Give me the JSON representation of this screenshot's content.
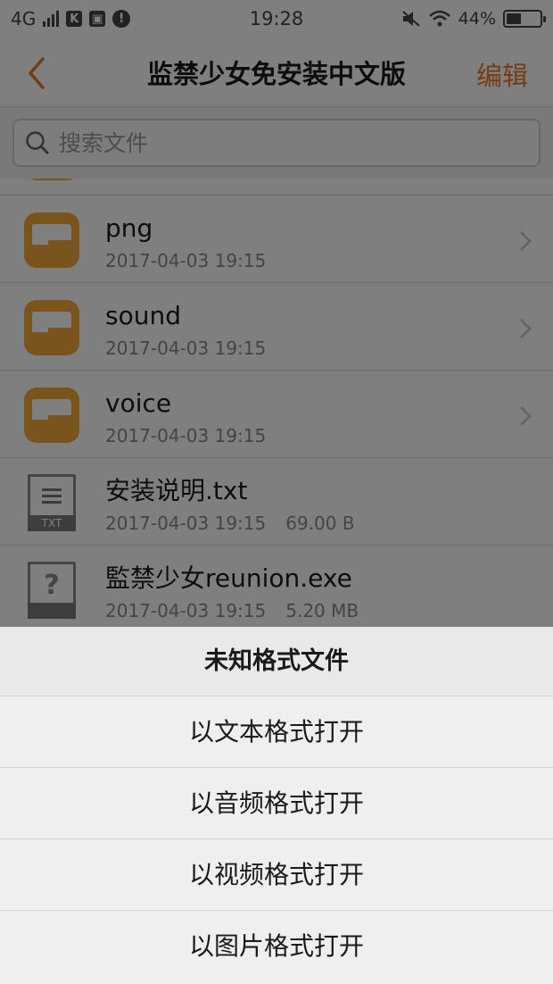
{
  "status_bar": {
    "network": "4G",
    "time": "19:28",
    "battery": "44%",
    "battery_level": 0.44,
    "icons": [
      "signal-icon",
      "k-app-icon",
      "gallery-icon",
      "alert-icon",
      "mute-icon",
      "wifi-icon",
      "battery-icon"
    ]
  },
  "nav": {
    "title": "监禁少女免安装中文版",
    "edit_label": "编辑"
  },
  "search": {
    "placeholder": "搜索文件",
    "value": ""
  },
  "files": [
    {
      "name": "",
      "type": "folder",
      "date": "",
      "size": ""
    },
    {
      "name": "png",
      "type": "folder",
      "date": "2017-04-03 19:15",
      "size": ""
    },
    {
      "name": "sound",
      "type": "folder",
      "date": "2017-04-03 19:15",
      "size": ""
    },
    {
      "name": "voice",
      "type": "folder",
      "date": "2017-04-03 19:15",
      "size": ""
    },
    {
      "name": "安装说明.txt",
      "type": "txt",
      "type_label": "TXT",
      "date": "2017-04-03 19:15",
      "size": "69.00 B"
    },
    {
      "name": "監禁少女reunion.exe",
      "type": "unknown",
      "date": "2017-04-03 19:15",
      "size": "5.20 MB"
    }
  ],
  "action_sheet": {
    "title": "未知格式文件",
    "options": [
      "以文本格式打开",
      "以音频格式打开",
      "以视频格式打开",
      "以图片格式打开"
    ]
  },
  "colors": {
    "accent": "#e8782b",
    "folder": "#f4a93a",
    "overlay": "rgba(0,0,0,0.5)"
  }
}
